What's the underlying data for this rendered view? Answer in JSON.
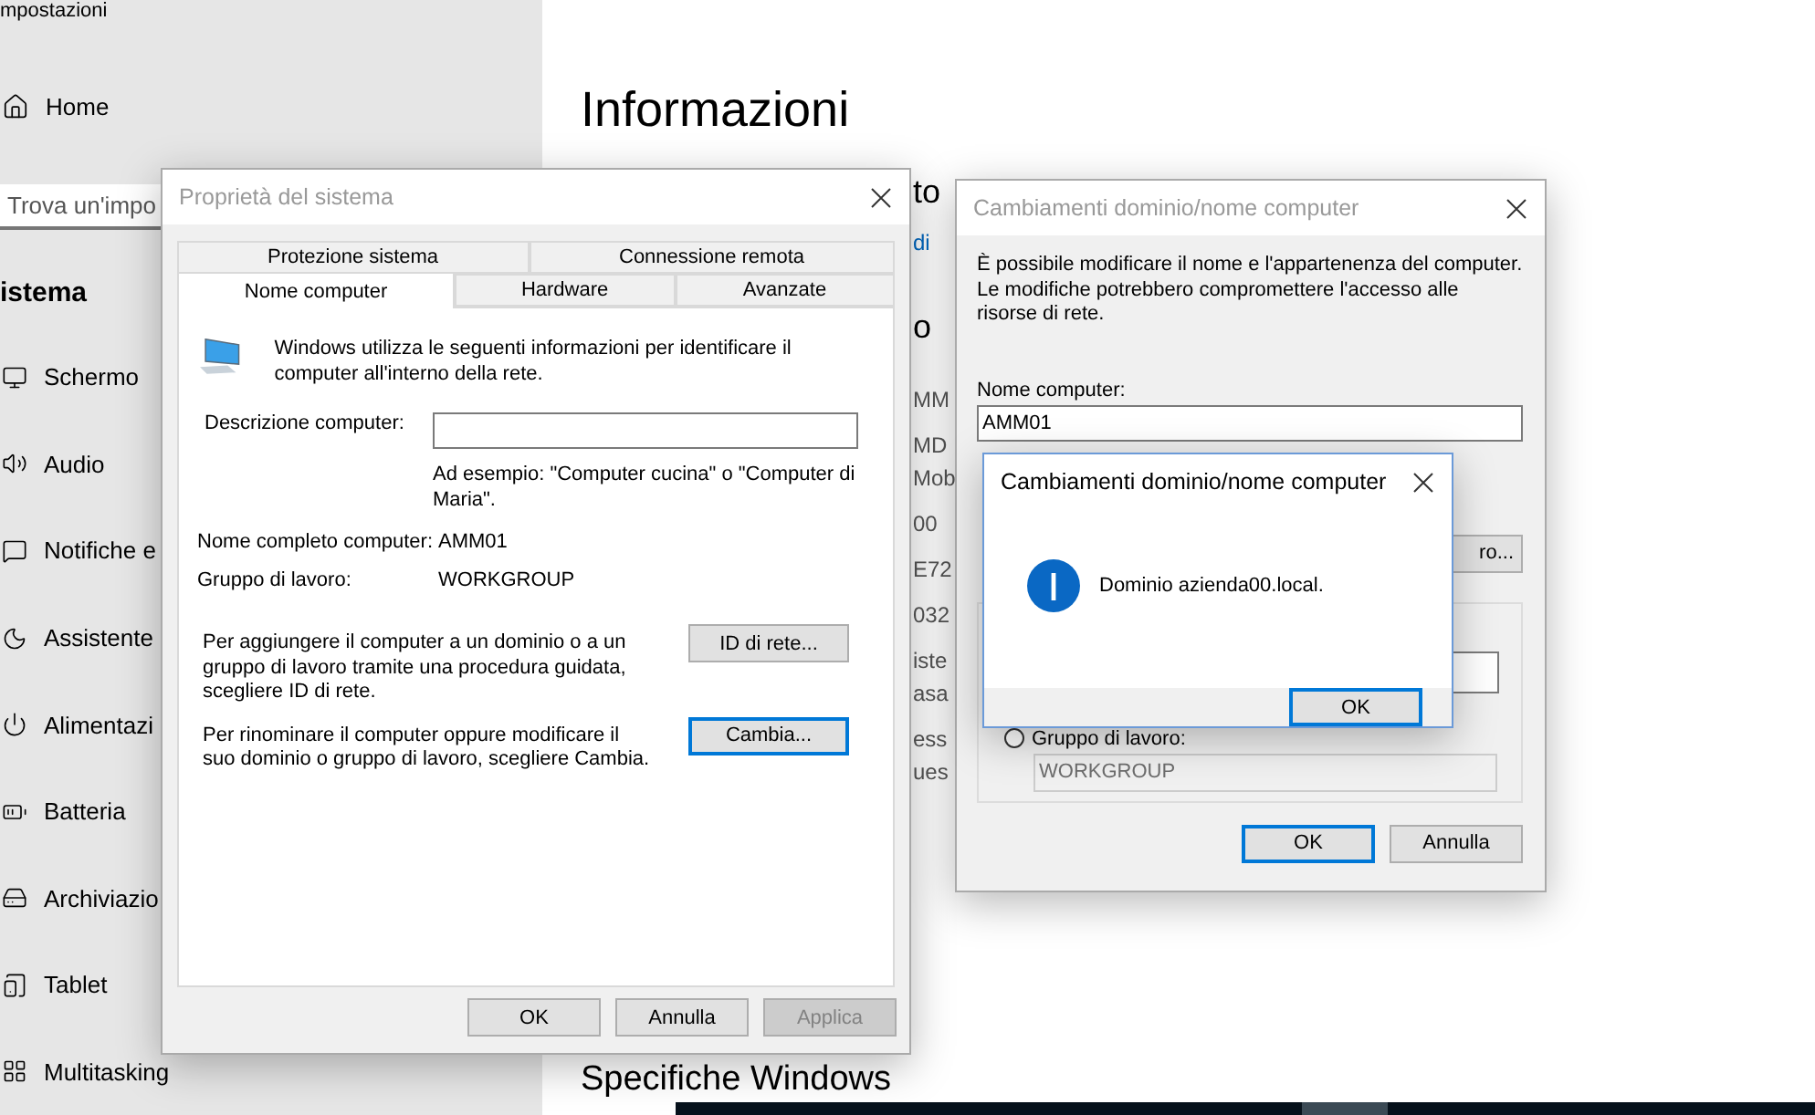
{
  "settings": {
    "app_title": "mpostazioni",
    "home": "Home",
    "search": {
      "placeholder": "Trova un'impo"
    },
    "section": "istema",
    "nav": [
      {
        "label": "Schermo"
      },
      {
        "label": "Audio"
      },
      {
        "label": "Notifiche e"
      },
      {
        "label": "Assistente"
      },
      {
        "label": "Alimentazi"
      },
      {
        "label": "Batteria"
      },
      {
        "label": "Archiviazio"
      },
      {
        "label": "Tablet"
      },
      {
        "label": "Multitasking"
      }
    ],
    "page_title": "Informazioni",
    "fragments": [
      {
        "kind": "heading",
        "lines": [
          "to"
        ]
      },
      {
        "kind": "link",
        "lines": [
          "di"
        ]
      },
      {
        "kind": "heading",
        "lines": [
          "o"
        ]
      },
      {
        "kind": "value",
        "lines": [
          "MM"
        ]
      },
      {
        "kind": "value",
        "lines": [
          "MD",
          "Mob"
        ]
      },
      {
        "kind": "value",
        "lines": [
          "00"
        ]
      },
      {
        "kind": "value",
        "lines": [
          "E72"
        ]
      },
      {
        "kind": "value",
        "lines": [
          "032"
        ]
      },
      {
        "kind": "value",
        "lines": [
          "iste",
          "asa"
        ]
      },
      {
        "kind": "value",
        "lines": [
          "ess",
          "ues"
        ]
      }
    ],
    "bottom_heading": "Specifiche Windows"
  },
  "system_properties": {
    "title": "Proprietà del sistema",
    "active": false,
    "tab_rows": [
      [
        {
          "label": "Protezione sistema",
          "selected": false
        },
        {
          "label": "Connessione remota",
          "selected": false
        }
      ],
      [
        {
          "label": "Nome computer",
          "selected": true
        },
        {
          "label": "Hardware",
          "selected": false
        },
        {
          "label": "Avanzate",
          "selected": false
        }
      ]
    ],
    "intro": "Windows utilizza le seguenti informazioni per identificare il computer all'interno della rete.",
    "description_label": "Descrizione computer:",
    "description_hint": "Ad esempio: \"Computer cucina\" o \"Computer di Maria\".",
    "full_name_label": "Nome completo computer:",
    "full_name": "AMM01",
    "workgroup_label": "Gruppo di lavoro:",
    "workgroup": "WORKGROUP",
    "actions": [
      {
        "text": "Per aggiungere il computer a un dominio o a un gruppo di lavoro tramite una procedura guidata, scegliere ID di rete.",
        "button": "ID di rete...",
        "focused": false
      },
      {
        "text": "Per rinominare il computer oppure modificare il suo dominio o gruppo di lavoro, scegliere Cambia.",
        "button": "Cambia...",
        "focused": true
      }
    ],
    "buttons": [
      {
        "label": "OK",
        "disabled": false
      },
      {
        "label": "Annulla",
        "disabled": false
      },
      {
        "label": "Applica",
        "disabled": true
      }
    ]
  },
  "change_dialog": {
    "title": "Cambiamenti dominio/nome computer",
    "active": false,
    "intro": "È possibile modificare il nome e l'appartenenza del computer. Le modifiche potrebbero compromettere l'accesso alle risorse di rete.",
    "name_label": "Nome computer:",
    "name_value": "AMM01",
    "more_button": "ro...",
    "workgroup_option": {
      "label": "Gruppo di lavoro:",
      "selected": false
    },
    "workgroup_value": "WORKGROUP",
    "buttons": [
      {
        "label": "OK",
        "focused": true
      },
      {
        "label": "Annulla",
        "focused": false
      }
    ]
  },
  "message_box": {
    "title": "Cambiamenti dominio/nome computer",
    "active": true,
    "message": "Dominio azienda00.local.",
    "button": "OK"
  }
}
